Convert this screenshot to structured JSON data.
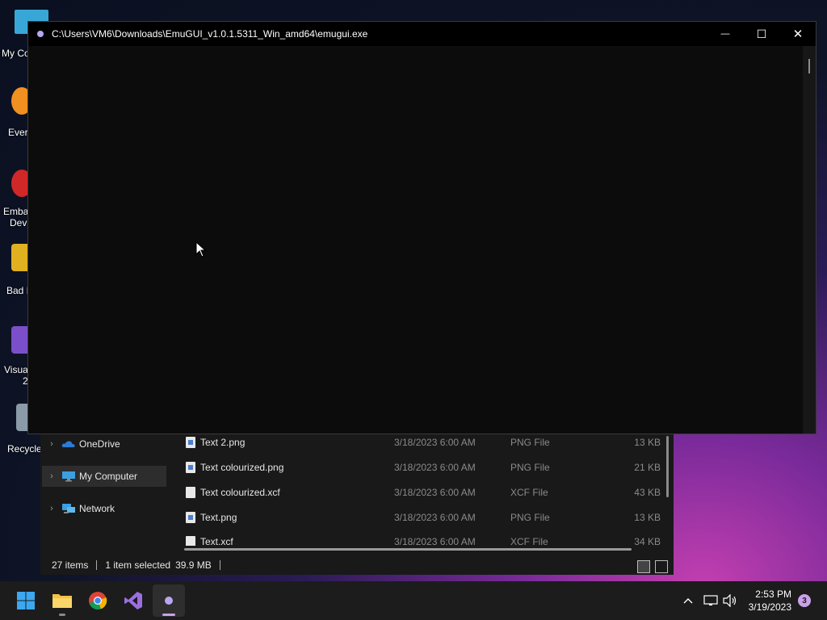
{
  "desktop": {
    "icons": [
      {
        "label": "My Co",
        "color": "#39a6d8"
      },
      {
        "label": "Ever",
        "color": "#f09020"
      },
      {
        "label": "Emba",
        "label2": "Dev",
        "color": "#d02828"
      },
      {
        "label": "Bad I",
        "color": "#e0b020"
      },
      {
        "label": "Visua",
        "label2": "2",
        "color": "#7b4fc9"
      },
      {
        "label": "Recycle",
        "color": "#8a9aa8"
      }
    ]
  },
  "app_window": {
    "title": "C:\\Users\\VM6\\Downloads\\EmuGUI_v1.0.1.5311_Win_amd64\\emugui.exe",
    "minimize_symbol": "—",
    "maximize_symbol": "☐",
    "close_symbol": "✕"
  },
  "explorer": {
    "nav": [
      {
        "label": "OneDrive",
        "icon": "onedrive-icon"
      },
      {
        "label": "My Computer",
        "icon": "computer-icon",
        "selected": true
      },
      {
        "label": "Network",
        "icon": "network-icon"
      }
    ],
    "files": [
      {
        "name": "Text 2.png",
        "date": "3/18/2023 6:00 AM",
        "type": "PNG File",
        "size": "13 KB",
        "kind": "png"
      },
      {
        "name": "Text colourized.png",
        "date": "3/18/2023 6:00 AM",
        "type": "PNG File",
        "size": "21 KB",
        "kind": "png"
      },
      {
        "name": "Text colourized.xcf",
        "date": "3/18/2023 6:00 AM",
        "type": "XCF File",
        "size": "43 KB",
        "kind": "xcf"
      },
      {
        "name": "Text.png",
        "date": "3/18/2023 6:00 AM",
        "type": "PNG File",
        "size": "13 KB",
        "kind": "png"
      },
      {
        "name": "Text.xcf",
        "date": "3/18/2023 6:00 AM",
        "type": "XCF File",
        "size": "34 KB",
        "kind": "xcf"
      }
    ],
    "status": {
      "items": "27 items",
      "selected": "1 item selected",
      "size": "39.9 MB"
    }
  },
  "taskbar": {
    "apps": [
      {
        "name": "start-button",
        "icon": "windows-icon"
      },
      {
        "name": "file-explorer",
        "icon": "folder-icon",
        "running": true
      },
      {
        "name": "chrome",
        "icon": "chrome-icon"
      },
      {
        "name": "visual-studio",
        "icon": "visual-studio-icon"
      },
      {
        "name": "emugui",
        "icon": "emugui-icon",
        "active": true
      }
    ],
    "tray": {
      "chevron": "^",
      "time": "2:53 PM",
      "date": "3/19/2023",
      "notifications": "3"
    }
  }
}
